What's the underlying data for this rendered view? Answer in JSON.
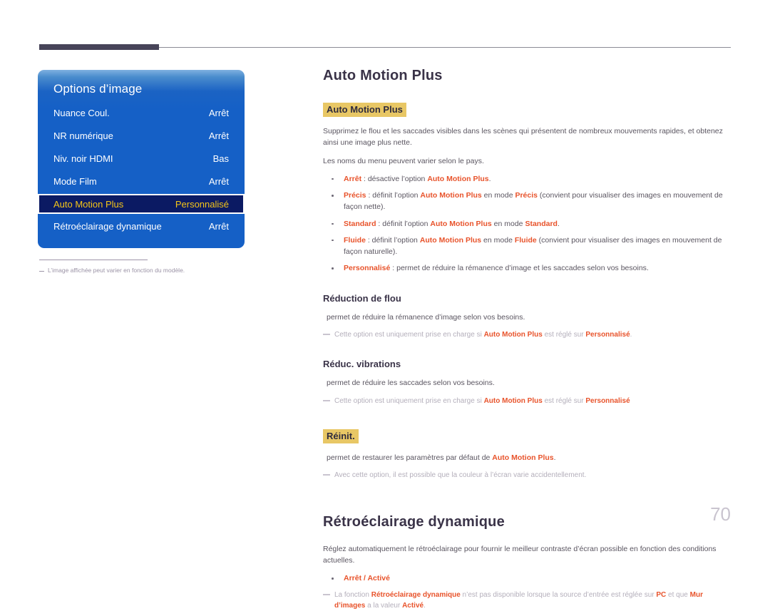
{
  "page": {
    "number": "70"
  },
  "osd": {
    "title": "Options d’image",
    "rows": [
      {
        "label": "Nuance Coul.",
        "value": "Arrêt",
        "selected": false
      },
      {
        "label": "NR numérique",
        "value": "Arrêt",
        "selected": false
      },
      {
        "label": "Niv. noir HDMI",
        "value": "Bas",
        "selected": false
      },
      {
        "label": "Mode Film",
        "value": "Arrêt",
        "selected": false
      },
      {
        "label": "Auto Motion Plus",
        "value": "Personnalisé",
        "selected": true
      },
      {
        "label": "Rétroéclairage dynamique",
        "value": "Arrêt",
        "selected": false
      }
    ],
    "footnote": "L’image affichée peut varier en fonction du modèle."
  },
  "sections": {
    "auto_motion_plus": {
      "title": "Auto Motion Plus",
      "highlight_head": "Auto Motion Plus",
      "intro": "Supprimez le flou et les saccades visibles dans les scènes qui présentent de nombreux mouvements rapides, et obtenez ainsi une image plus nette.",
      "intro2": "Les noms du menu peuvent varier selon le pays.",
      "bullets": [
        {
          "term": "Arrêt",
          "rest_1": " : désactive l’option ",
          "emph_1": "Auto Motion Plus",
          "rest_2": "."
        },
        {
          "term": "Précis",
          "rest_1": " : définit l’option ",
          "emph_1": "Auto Motion Plus",
          "rest_2": " en mode ",
          "emph_2": "Précis",
          "rest_3": " (convient pour visualiser des images en mouvement de façon nette)."
        },
        {
          "term": "Standard",
          "rest_1": " : définit l’option ",
          "emph_1": "Auto Motion Plus",
          "rest_2": " en mode ",
          "emph_2": "Standard",
          "rest_3": "."
        },
        {
          "term": "Fluide",
          "rest_1": " : définit l’option ",
          "emph_1": "Auto Motion Plus",
          "rest_2": " en mode ",
          "emph_2": "Fluide",
          "rest_3": " (convient pour visualiser des images en mouvement de façon naturelle)."
        },
        {
          "term": "Personnalisé",
          "rest_1": " : permet de réduire la rémanence d’image et les saccades selon vos besoins.",
          "emph_1": "",
          "rest_2": ""
        }
      ]
    },
    "reduction_flou": {
      "heading": "Réduction de flou",
      "text": "permet de réduire la rémanence d’image selon vos besoins.",
      "note_1": "Cette option est uniquement prise en charge si ",
      "note_emph_1": "Auto Motion Plus",
      "note_2": " est réglé sur ",
      "note_emph_2": "Personnalisé",
      "note_3": "."
    },
    "reduc_vibrations": {
      "heading": "Réduc. vibrations",
      "text": "permet de réduire les saccades selon vos besoins.",
      "note_1": "Cette option est uniquement prise en charge si ",
      "note_emph_1": "Auto Motion Plus",
      "note_2": " est réglé sur ",
      "note_emph_2": "Personnalisé",
      "note_3": ""
    },
    "reinit": {
      "highlight_head": "Réinit.",
      "text_1": "permet de restaurer les paramètres par défaut de ",
      "emph_1": "Auto Motion Plus",
      "text_2": ".",
      "note": "Avec cette option, il est possible que la couleur à l’écran varie accidentellement."
    },
    "retroeclairage": {
      "title": "Rétroéclairage dynamique",
      "intro": "Réglez automatiquement le rétroéclairage pour fournir le meilleur contraste d’écran possible en fonction des conditions actuelles.",
      "bullet": "Arrêt / Activé",
      "note_1": "La fonction ",
      "note_emph_1": "Rétroéclairage dynamique",
      "note_2": " n’est pas disponible lorsque la source d’entrée est réglée sur ",
      "note_emph_2": "PC",
      "note_3": " et que ",
      "note_emph_3": "Mur d’images",
      "note_4": " a la valeur ",
      "note_emph_4": "Activé",
      "note_5": "."
    }
  },
  "colors": {
    "accent_orange": "#e8532b",
    "highlight_gold": "#e8c765",
    "osd_blue": "#1560c6",
    "osd_selected": "#0b1a63",
    "osd_selected_text": "#f5c518"
  }
}
